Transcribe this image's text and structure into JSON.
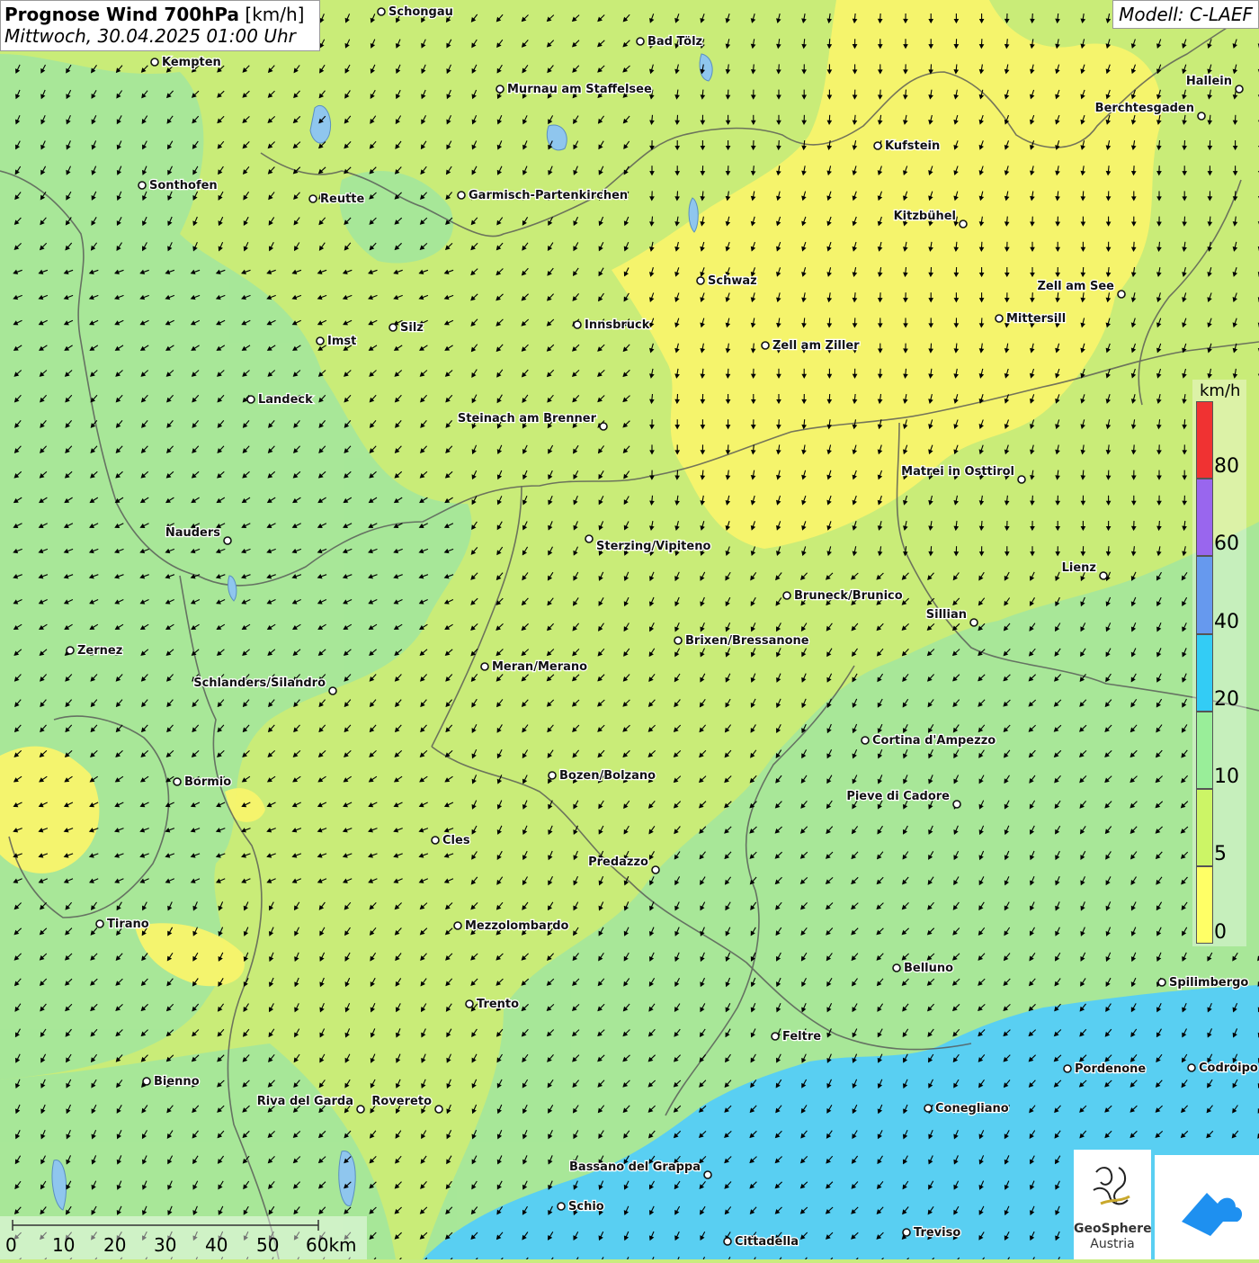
{
  "header": {
    "title_bold": "Prognose Wind 700hPa",
    "title_unit": "[km/h]",
    "datetime": "Mittwoch, 30.04.2025 01:00 Uhr",
    "model": "Modell: C-LAEF"
  },
  "legend": {
    "unit": "km/h",
    "labels": [
      "80",
      "60",
      "40",
      "20",
      "10",
      "5",
      "0"
    ],
    "colors": [
      "#f03232",
      "#9966ee",
      "#6699ee",
      "#33ccf5",
      "#99ee99",
      "#ccf566",
      "#ffff66"
    ]
  },
  "scale_bar": {
    "labels": [
      "0",
      "10",
      "20",
      "30",
      "40",
      "50",
      "60km"
    ]
  },
  "logos": {
    "geosphere_name": "GeoSphere",
    "geosphere_sub": "Austria",
    "app_icon": "wind-app-icon"
  },
  "map_colors": {
    "calm_yellow": "#fbf56e",
    "light_green_yellow": "#d5ef6c",
    "green": "#9fe69b",
    "cyan": "#59d0f3",
    "border": "#555555",
    "lake": "#8fc6ee"
  },
  "cities": [
    {
      "name": "Schongau"
    },
    {
      "name": "Bad Tölz"
    },
    {
      "name": "Kempten"
    },
    {
      "name": "Murnau am Staffelsee"
    },
    {
      "name": "Hallein"
    },
    {
      "name": "Berchtesgaden"
    },
    {
      "name": "Kufstein"
    },
    {
      "name": "Sonthofen"
    },
    {
      "name": "Reutte"
    },
    {
      "name": "Garmisch-Partenkirchen"
    },
    {
      "name": "Kitzbühel"
    },
    {
      "name": "Schwaz"
    },
    {
      "name": "Zell am See"
    },
    {
      "name": "Mittersill"
    },
    {
      "name": "Imst"
    },
    {
      "name": "Silz"
    },
    {
      "name": "Innsbruck"
    },
    {
      "name": "Zell am Ziller"
    },
    {
      "name": "Landeck"
    },
    {
      "name": "Steinach am Brenner"
    },
    {
      "name": "Matrei in Osttirol"
    },
    {
      "name": "Nauders"
    },
    {
      "name": "Sterzing/Vipiteno"
    },
    {
      "name": "Lienz"
    },
    {
      "name": "Bruneck/Brunico"
    },
    {
      "name": "Sillian"
    },
    {
      "name": "Zernez"
    },
    {
      "name": "Brixen/Bressanone"
    },
    {
      "name": "Meran/Merano"
    },
    {
      "name": "Schlanders/Silandro"
    },
    {
      "name": "Cortina d'Ampezzo"
    },
    {
      "name": "Bormio"
    },
    {
      "name": "Bozen/Bolzano"
    },
    {
      "name": "Pieve di Cadore"
    },
    {
      "name": "Cles"
    },
    {
      "name": "Predazzo"
    },
    {
      "name": "Tirano"
    },
    {
      "name": "Mezzolombardo"
    },
    {
      "name": "Belluno"
    },
    {
      "name": "Spilimbergo"
    },
    {
      "name": "Trento"
    },
    {
      "name": "Feltre"
    },
    {
      "name": "Pordenone"
    },
    {
      "name": "Codroipo"
    },
    {
      "name": "Bienno"
    },
    {
      "name": "Riva del Garda"
    },
    {
      "name": "Rovereto"
    },
    {
      "name": "Conegliano"
    },
    {
      "name": "Bassano del Grappa"
    },
    {
      "name": "Schio"
    },
    {
      "name": "Treviso"
    },
    {
      "name": "Cittadella"
    }
  ]
}
